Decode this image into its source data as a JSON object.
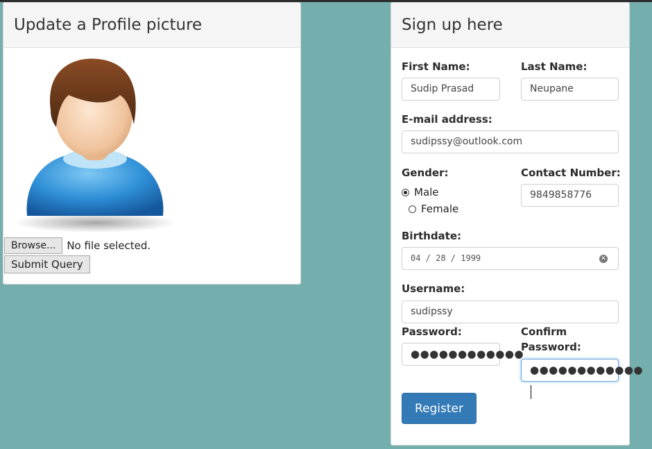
{
  "profile_panel": {
    "title": "Update a Profile picture",
    "browse_label": "Browse...",
    "file_status": "No file selected.",
    "submit_label": "Submit Query"
  },
  "signup_panel": {
    "title": "Sign up here",
    "first_name": {
      "label": "First Name:",
      "value": "Sudip Prasad"
    },
    "last_name": {
      "label": "Last Name:",
      "value": "Neupane"
    },
    "email": {
      "label": "E-mail address:",
      "value": "sudipssy@outlook.com"
    },
    "gender": {
      "label": "Gender:",
      "options": [
        "Male",
        "Female"
      ],
      "selected": "Male"
    },
    "contact": {
      "label": "Contact Number:",
      "value": "9849858776"
    },
    "birthdate": {
      "label": "Birthdate:",
      "value": "04 / 28 / 1999"
    },
    "username": {
      "label": "Username:",
      "value": "sudipssy"
    },
    "password": {
      "label": "Password:",
      "value": "●●●●●●●●●●●●"
    },
    "confirm_password": {
      "label_line1": "Confirm",
      "label_line2": "Password:",
      "value": "●●●●●●●●●●●●"
    },
    "register_label": "Register"
  },
  "icons": {
    "avatar": "user-avatar-icon",
    "clear": "clear-date-icon"
  },
  "colors": {
    "background": "#75afad",
    "primary_button": "#337ab7",
    "panel_heading": "#f5f5f5"
  }
}
